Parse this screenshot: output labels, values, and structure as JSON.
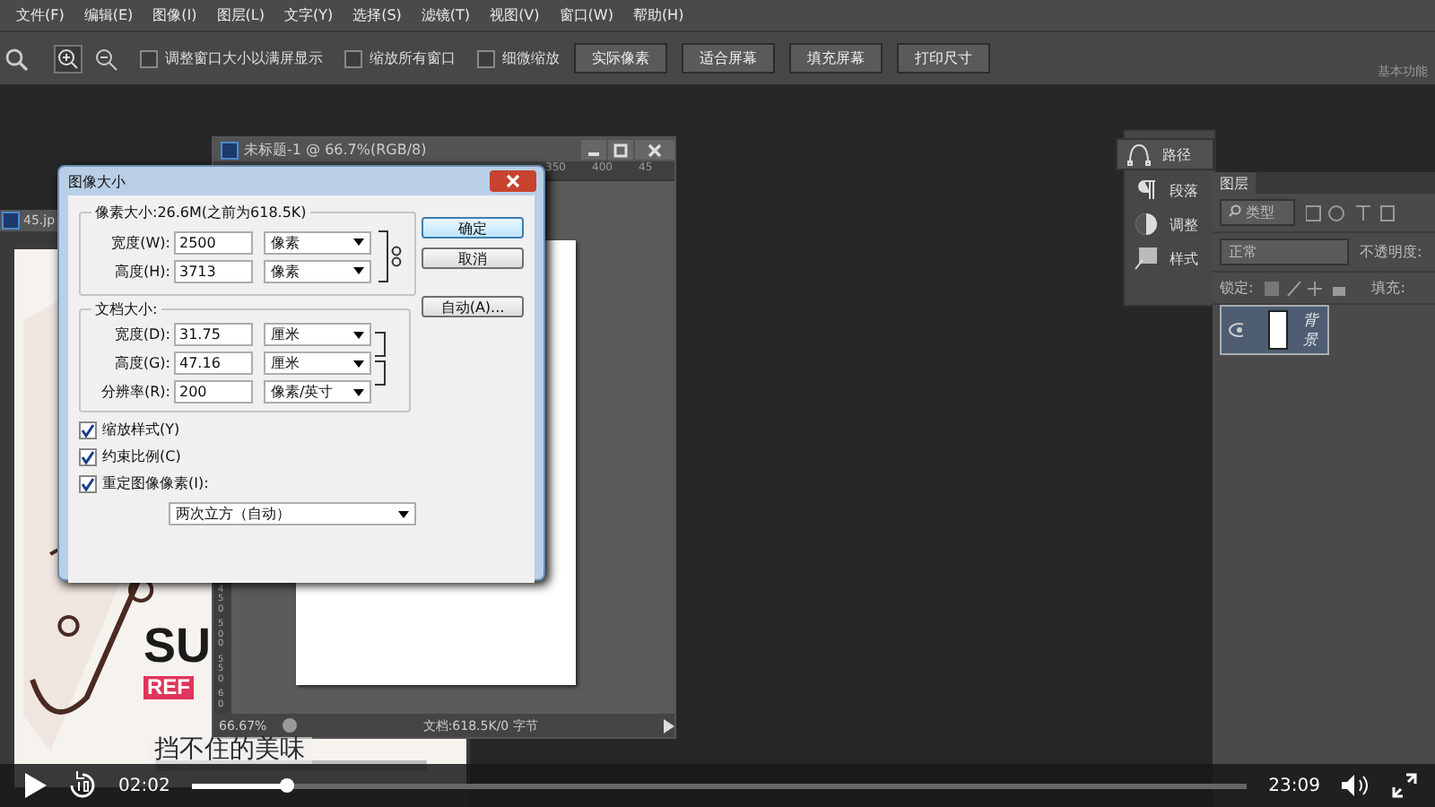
{
  "menu": [
    {
      "label": "文件(F)"
    },
    {
      "label": "编辑(E)"
    },
    {
      "label": "图像(I)"
    },
    {
      "label": "图层(L)"
    },
    {
      "label": "文字(Y)"
    },
    {
      "label": "选择(S)"
    },
    {
      "label": "滤镜(T)"
    },
    {
      "label": "视图(V)"
    },
    {
      "label": "窗口(W)"
    },
    {
      "label": "帮助(H)"
    }
  ],
  "options": {
    "checkboxes": [
      {
        "label": "调整窗口大小以满屏显示",
        "checked": false
      },
      {
        "label": "缩放所有窗口",
        "checked": false
      },
      {
        "label": "细微缩放",
        "checked": false
      }
    ],
    "buttons": [
      "实际像素",
      "适合屏幕",
      "填充屏幕",
      "打印尺寸"
    ],
    "workspace": "基本功能"
  },
  "documents": [
    {
      "title": "45.jp",
      "poster": {
        "headline": "SU",
        "tag": "REF"
      }
    },
    {
      "title": "未标题-1 @ 66.7%(RGB/8)",
      "ruler": [
        "350",
        "400",
        "45"
      ],
      "vruler": [
        "450",
        "500",
        "550",
        "60"
      ],
      "zoom": "66.67%",
      "status": "文档:618.5K/0 字节"
    }
  ],
  "dialog": {
    "title": "图像大小",
    "pixel_group": "像素大小:26.6M(之前为618.5K)",
    "pixel_rows": [
      {
        "label": "宽度(W):",
        "value": "2500",
        "unit": "像素"
      },
      {
        "label": "高度(H):",
        "value": "3713",
        "unit": "像素"
      }
    ],
    "doc_group": "文档大小:",
    "doc_rows": [
      {
        "label": "宽度(D):",
        "value": "31.75",
        "unit": "厘米",
        "linked": true
      },
      {
        "label": "高度(G):",
        "value": "47.16",
        "unit": "厘米",
        "linked": true
      },
      {
        "label": "分辨率(R):",
        "value": "200",
        "unit": "像素/英寸",
        "linked": false
      }
    ],
    "buttons": [
      {
        "label": "确定",
        "selected": true
      },
      {
        "label": "取消",
        "selected": false
      },
      {
        "label": "自动(A)...",
        "selected": false
      }
    ],
    "checkboxes": [
      {
        "label": "缩放样式(Y)",
        "checked": true
      },
      {
        "label": "约束比例(C)",
        "checked": true
      },
      {
        "label": "重定图像像素(I):",
        "checked": true
      }
    ],
    "resample": "两次立方（自动）"
  },
  "dock": [
    {
      "kind": "path",
      "label": "路径"
    },
    {
      "kind": "paragraph",
      "label": "段落"
    },
    {
      "kind": "adjust",
      "label": "调整"
    },
    {
      "kind": "style",
      "label": "样式"
    }
  ],
  "layers": {
    "tab": "图层",
    "filter": "类型",
    "blend": "正常",
    "opacity_label": "不透明度:",
    "lock_label": "锁定:",
    "fill_label": "填充:",
    "items": [
      {
        "name": "背景",
        "visible": true,
        "selected": true
      }
    ]
  },
  "player": {
    "subtitle": "挡不住的美味",
    "current": "02:02",
    "duration": "23:09",
    "level": 0.09
  }
}
